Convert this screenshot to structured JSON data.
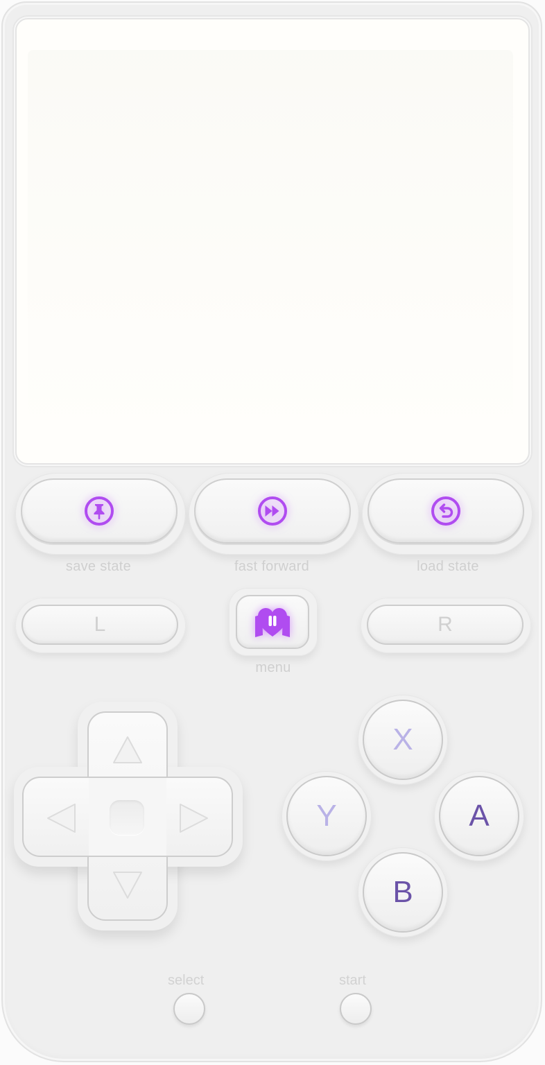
{
  "controls": {
    "save_state": "save state",
    "fast_forward": "fast forward",
    "load_state": "load state",
    "menu": "menu",
    "shoulder_left": "L",
    "shoulder_right": "R",
    "select": "select",
    "start": "start"
  },
  "face_buttons": {
    "x": "X",
    "y": "Y",
    "a": "A",
    "b": "B"
  },
  "colors": {
    "accent": "#b04cf0",
    "face_a_b": "#6b53a8",
    "face_x_y": "#b9b2e6",
    "shell": "#efefef"
  },
  "icons": {
    "save_state": "pin-icon",
    "fast_forward": "fast-forward-icon",
    "load_state": "undo-icon",
    "menu": "heart-icon",
    "dpad": [
      "up-arrow-icon",
      "left-arrow-icon",
      "right-arrow-icon",
      "down-arrow-icon"
    ]
  }
}
